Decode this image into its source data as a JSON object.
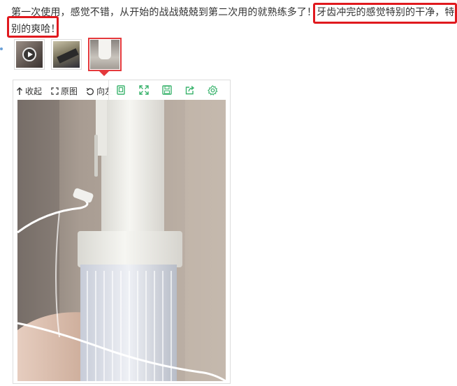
{
  "review": {
    "text_plain": "第一次使用，感觉不错，从开始的战战兢兢到第二次用的就熟练多了！",
    "text_highlight_1": "牙齿冲完的感觉特别的干净，特",
    "text_highlight_2": "别的爽哈！"
  },
  "thumbnails": [
    {
      "name": "video thumbnail",
      "is_video": true
    },
    {
      "name": "photo thumbnail 2",
      "is_video": false
    },
    {
      "name": "photo thumbnail 3",
      "is_video": false,
      "selected": true
    }
  ],
  "viewer": {
    "collapse_label": "收起",
    "original_label": "原图",
    "rotate_label": "向左",
    "icon_names": [
      "fit-window-icon",
      "fullscreen-icon",
      "save-icon",
      "share-icon",
      "settings-icon"
    ]
  },
  "colors": {
    "highlight_box": "#e0191e",
    "active_thumb_border": "#e4393c",
    "icon_green": "#3cb46e",
    "text": "#333333"
  }
}
